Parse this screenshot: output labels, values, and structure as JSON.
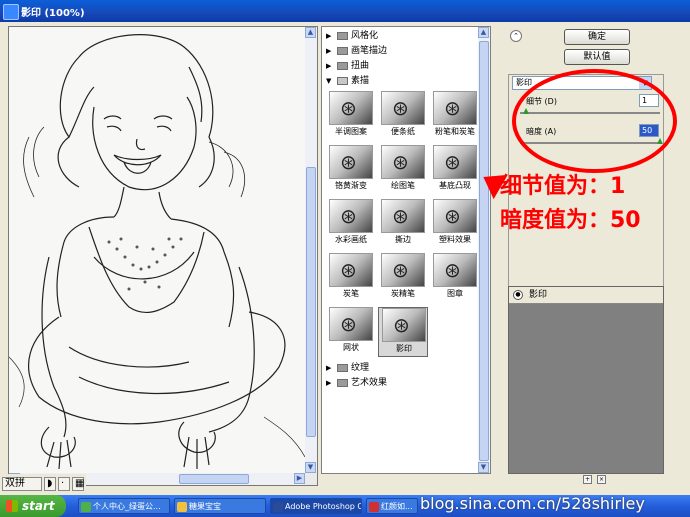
{
  "window": {
    "title": "影印 (100%)"
  },
  "preview": {
    "zoom_items": [
      "双拼"
    ]
  },
  "gallery": {
    "categories": [
      {
        "label": "风格化",
        "expanded": false
      },
      {
        "label": "画笔描边",
        "expanded": false
      },
      {
        "label": "扭曲",
        "expanded": false
      },
      {
        "label": "素描",
        "expanded": true
      }
    ],
    "filters": [
      "半调图案",
      "便条纸",
      "粉笔和炭笔",
      "铬黄渐变",
      "绘图笔",
      "基底凸现",
      "水彩画纸",
      "撕边",
      "塑料效果",
      "炭笔",
      "炭精笔",
      "图章",
      "网状",
      "影印"
    ],
    "selected_filter": "影印",
    "bottom_categories": [
      {
        "label": "纹理",
        "expanded": false
      },
      {
        "label": "艺术效果",
        "expanded": false
      }
    ]
  },
  "buttons": {
    "ok": "确定",
    "default": "默认值"
  },
  "settings": {
    "filter_select": "影印",
    "detail_label": "细节 (D)",
    "detail_value": "1",
    "darkness_label": "暗度 (A)",
    "darkness_value": "50",
    "detail_level": 0.04,
    "darkness_level": 1.0
  },
  "annotation": {
    "line1": "细节值为：1",
    "line2": "暗度值为：50",
    "color": "#ff0000"
  },
  "layers": {
    "items": [
      "影印"
    ]
  },
  "taskbar": {
    "start": "start",
    "items": [
      "个人中心_绿蛋公...",
      "糖果宝宝",
      "Adobe Photoshop C...",
      "红颜如..."
    ]
  },
  "watermark": "blog.sina.com.cn/528shirley"
}
